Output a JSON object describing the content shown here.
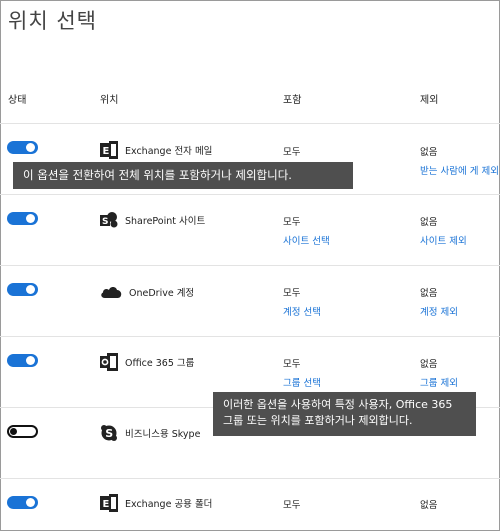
{
  "page_title": "위치 선택",
  "columns": {
    "status": "상태",
    "location": "위치",
    "include": "포함",
    "exclude": "제외"
  },
  "rows": [
    {
      "toggle": "on",
      "icon": "exchange-icon",
      "name": "Exchange 전자 메일",
      "include": "모두",
      "include_link": "",
      "exclude": "없음",
      "exclude_link": "받는 사람에 게 제외"
    },
    {
      "toggle": "on",
      "icon": "sharepoint-icon",
      "name": "SharePoint 사이트",
      "include": "모두",
      "include_link": "사이트 선택",
      "exclude": "없음",
      "exclude_link": "사이트 제외"
    },
    {
      "toggle": "on",
      "icon": "onedrive-icon",
      "name": "OneDrive 계정",
      "include": "모두",
      "include_link": "계정 선택",
      "exclude": "없음",
      "exclude_link": "계정 제외"
    },
    {
      "toggle": "on",
      "icon": "office365-icon",
      "name": "Office 365 그룹",
      "include": "모두",
      "include_link": "그룹 선택",
      "exclude": "없음",
      "exclude_link": "그룹 제외"
    },
    {
      "toggle": "off",
      "icon": "skype-icon",
      "name": "비즈니스용 Skype",
      "include": "",
      "include_link": "",
      "exclude": "",
      "exclude_link": ""
    },
    {
      "toggle": "on",
      "icon": "exchange-icon",
      "name": "Exchange 공용 폴더",
      "include": "모두",
      "include_link": "",
      "exclude": "없음",
      "exclude_link": ""
    }
  ],
  "tooltips": {
    "toggle_tip": "이 옵션을 전환하여 전체 위치를 포함하거나 제외합니다.",
    "options_tip_line1": "이러한 옵션을 사용하여 특정 사용자, Office 365",
    "options_tip_line2": "그룹 또는 위치를 포함하거나 제외합니다."
  },
  "colors": {
    "accent": "#1a73d6",
    "tooltip_bg": "#4f4f4f"
  }
}
